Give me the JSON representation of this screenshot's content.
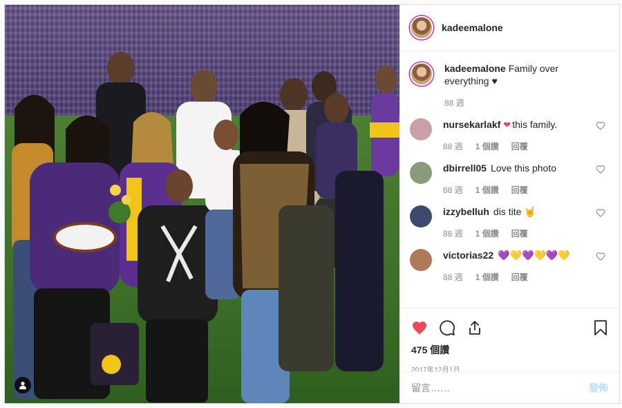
{
  "post": {
    "username": "kadeemalone",
    "caption": {
      "username": "kadeemalone",
      "text": "Family over everything ♥",
      "time": "88 週"
    },
    "comments": [
      {
        "username": "nursekarlakf",
        "text": "this family.",
        "emoji_prefix": "❤",
        "time": "88 週",
        "likes": "1 個讚",
        "reply": "回覆",
        "avatar_color": "#c9a0a8"
      },
      {
        "username": "dbirrell05",
        "text": "Love this photo",
        "emoji_prefix": "",
        "time": "88 週",
        "likes": "1 個讚",
        "reply": "回覆",
        "avatar_color": "#8a9a7a"
      },
      {
        "username": "izzybelluh",
        "text": "dis tite 🤘",
        "emoji_prefix": "",
        "time": "88 週",
        "likes": "1 個讚",
        "reply": "回覆",
        "avatar_color": "#3d4a6e"
      },
      {
        "username": "victorias22",
        "text": "💜💛💜💛💜💛",
        "emoji_prefix": "",
        "time": "88 週",
        "likes": "1 個讚",
        "reply": "回覆",
        "avatar_color": "#b07a5a"
      }
    ],
    "likes_count": "475 個讚",
    "date": "2017年12月1日",
    "add_comment_placeholder": "留言……",
    "post_button": "發佈",
    "icons": {
      "like": "heart-filled-icon",
      "comment": "comment-icon",
      "share": "share-icon",
      "save": "bookmark-icon",
      "user_tags": "user-tag-icon"
    },
    "colors": {
      "like_red": "#ed4956",
      "muted": "#8e8e8e",
      "post_button": "#b2dffc",
      "purple": "#7b54c7",
      "gold": "#f0c419"
    }
  }
}
